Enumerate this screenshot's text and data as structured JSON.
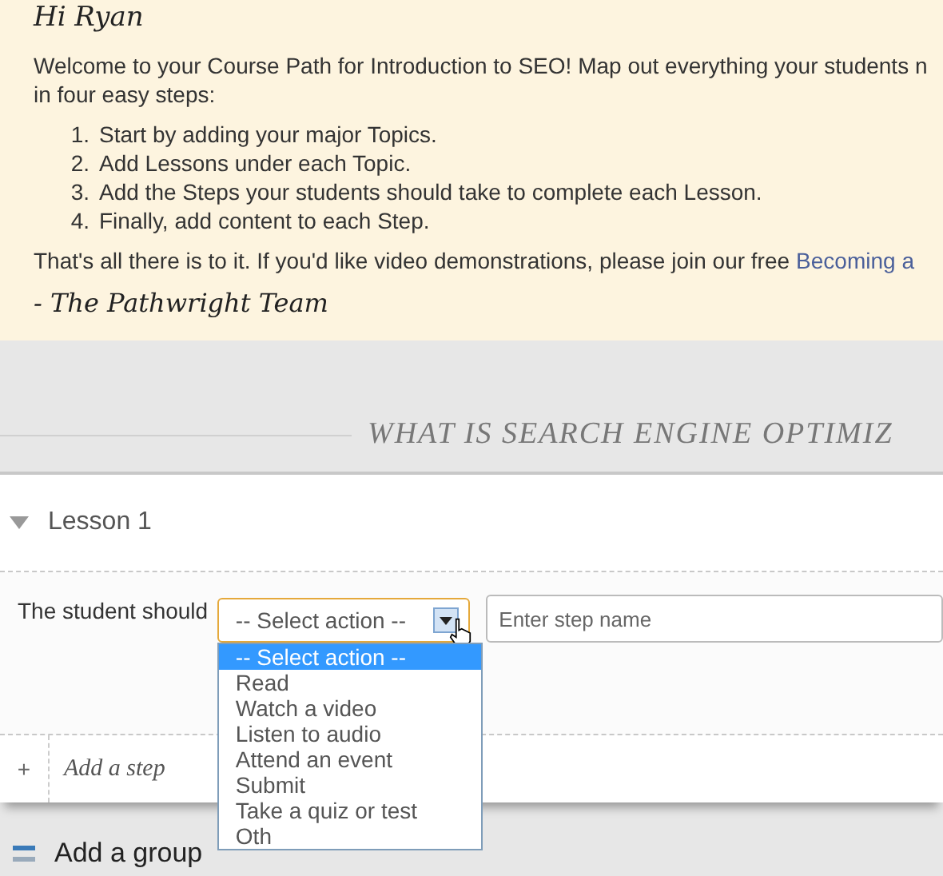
{
  "greeting": "Hi Ryan",
  "intro_lines": [
    "Welcome to your Course Path for Introduction to SEO! Map out everything your students n",
    "in four easy steps:"
  ],
  "steps": [
    {
      "number": "1.",
      "text": "Start by adding your major Topics."
    },
    {
      "number": "2.",
      "text": "Add Lessons under each Topic."
    },
    {
      "number": "3.",
      "text": "Add the Steps your students should take to complete each Lesson."
    },
    {
      "number": "4.",
      "text": "Finally, add content to each Step."
    }
  ],
  "outro": {
    "text": "That's all there is to it. If you'd like video demonstrations, please join our free",
    "link": "Becoming a"
  },
  "signature": "- The Pathwright Team",
  "section_title": "WHAT IS SEARCH ENGINE OPTIMIZ",
  "lesson": {
    "title": "Lesson 1",
    "expanded": true
  },
  "step_form": {
    "label": "The student should",
    "action_select": {
      "value": "-- Select action --",
      "open": true,
      "options": [
        {
          "label": "-- Select action --",
          "selected": true
        },
        {
          "label": "Read",
          "selected": false
        },
        {
          "label": "Watch a video",
          "selected": false
        },
        {
          "label": "Listen to audio",
          "selected": false
        },
        {
          "label": "Attend an event",
          "selected": false
        },
        {
          "label": "Submit",
          "selected": false
        },
        {
          "label": "Take a quiz or test",
          "selected": false
        },
        {
          "label": "Oth",
          "selected": false
        }
      ]
    },
    "step_name": {
      "placeholder": "Enter step name"
    }
  },
  "add_step": {
    "icon": "+",
    "label": "Add a step"
  },
  "add_group": {
    "label": "Add a group"
  }
}
